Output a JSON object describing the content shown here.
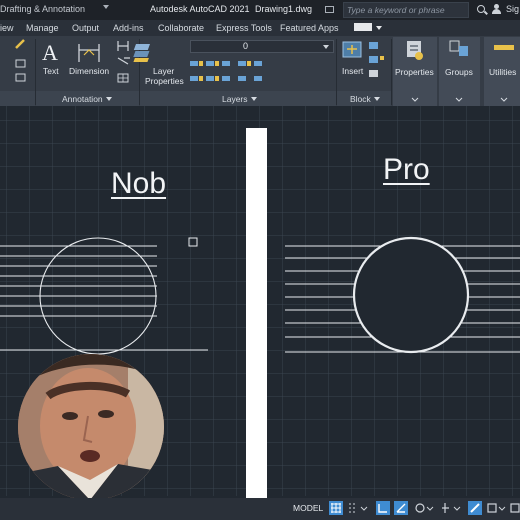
{
  "titlebar": {
    "workspace": "Drafting & Annotation",
    "app_title": "Autodesk AutoCAD 2021",
    "file_name": "Drawing1.dwg",
    "search_placeholder": "Type a keyword or phrase",
    "signin": "Sig"
  },
  "menu": {
    "items": [
      "iew",
      "Manage",
      "Output",
      "Add-ins",
      "Collaborate",
      "Express Tools",
      "Featured Apps"
    ]
  },
  "ribbon": {
    "text_label": "Text",
    "dimension_label": "Dimension",
    "annotation_panel": "Annotation",
    "layer_properties_line1": "Layer",
    "layer_properties_line2": "Properties",
    "layer_value": "0",
    "layers_panel": "Layers",
    "insert_label": "Insert",
    "block_panel": "Block",
    "properties_label": "Properties",
    "groups_label": "Groups",
    "utilities_label": "Utilities"
  },
  "drawing": {
    "left_label": "Nob",
    "right_label": "Pro"
  },
  "statusbar": {
    "model": "MODEL"
  },
  "colors": {
    "canvas": "#212830",
    "ribbon": "#353c46",
    "status_active": "#3f8cd2",
    "divider": "#ffffff"
  }
}
